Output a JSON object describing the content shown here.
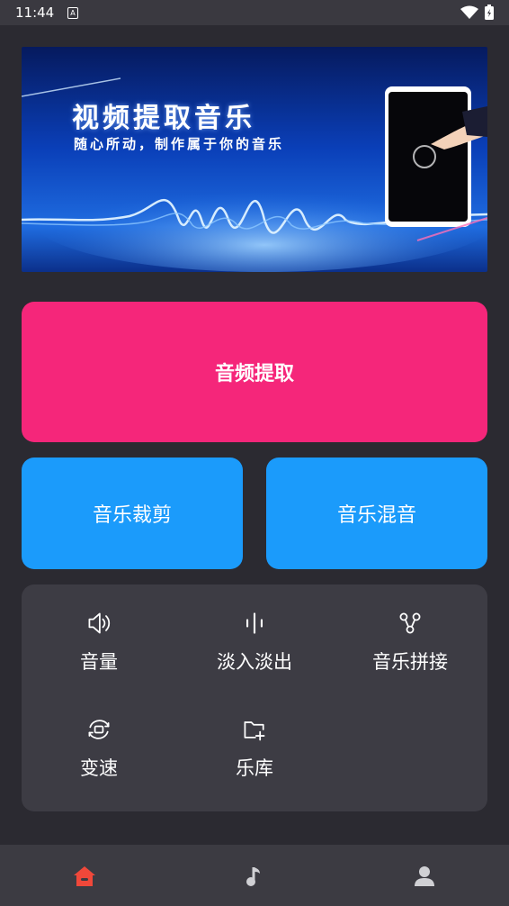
{
  "status_bar": {
    "time": "11:44",
    "notification_icon": "a-icon"
  },
  "banner": {
    "title": "视频提取音乐",
    "subtitle": "随心所动，制作属于你的音乐"
  },
  "actions": {
    "extract_label": "音频提取",
    "cut_label": "音乐裁剪",
    "mix_label": "音乐混音"
  },
  "tools": [
    {
      "label": "音量",
      "icon": "volume-icon"
    },
    {
      "label": "淡入淡出",
      "icon": "waveform-icon"
    },
    {
      "label": "音乐拼接",
      "icon": "merge-icon"
    },
    {
      "label": "变速",
      "icon": "speed-icon"
    },
    {
      "label": "乐库",
      "icon": "folder-add-icon"
    }
  ],
  "bottom_nav": [
    {
      "icon": "home-icon",
      "active": true
    },
    {
      "icon": "music-note-icon",
      "active": false
    },
    {
      "icon": "profile-icon",
      "active": false
    }
  ],
  "colors": {
    "accent_pink": "#f5267a",
    "accent_blue": "#1b9bfb",
    "active_nav": "#f0483a"
  }
}
